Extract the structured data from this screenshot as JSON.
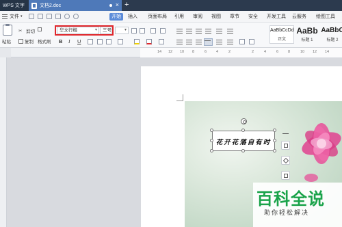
{
  "tabs": {
    "app": "WPS 文字",
    "document": "文档2.doc"
  },
  "menu": {
    "file": "文件",
    "items": [
      "开始",
      "插入",
      "页面布局",
      "引用",
      "审阅",
      "视图",
      "章节",
      "安全",
      "开发工具",
      "云服务",
      "绘图工具"
    ],
    "active": "开始"
  },
  "toolbar": {
    "paste": "粘贴",
    "cut": "剪切",
    "copy": "复制",
    "format_painter": "格式刷",
    "font_name": "华文行楷",
    "font_size": "三号",
    "bold": "B",
    "italic": "I",
    "underline": "U",
    "styles": [
      {
        "sample": "AaBbCcDd",
        "name": "正文"
      },
      {
        "sample": "AaBb",
        "name": "标题 1"
      },
      {
        "sample": "AaBbC",
        "name": "标题 2"
      }
    ]
  },
  "ruler": {
    "numbers": [
      "14",
      "12",
      "10",
      "8",
      "6",
      "4",
      "2",
      "2",
      "4",
      "6",
      "8",
      "10",
      "12",
      "14"
    ]
  },
  "document": {
    "textbox_text": "花开花落自有时"
  },
  "watermark": {
    "logo": "百科全说",
    "subtitle": "助你轻松解决"
  },
  "colors": {
    "tab_bg": "#2c3a4e",
    "active_tab": "#4e79b9",
    "accent": "#5b8bd9",
    "highlight_box": "#e0262b",
    "watermark_green": "#1aa34a"
  }
}
